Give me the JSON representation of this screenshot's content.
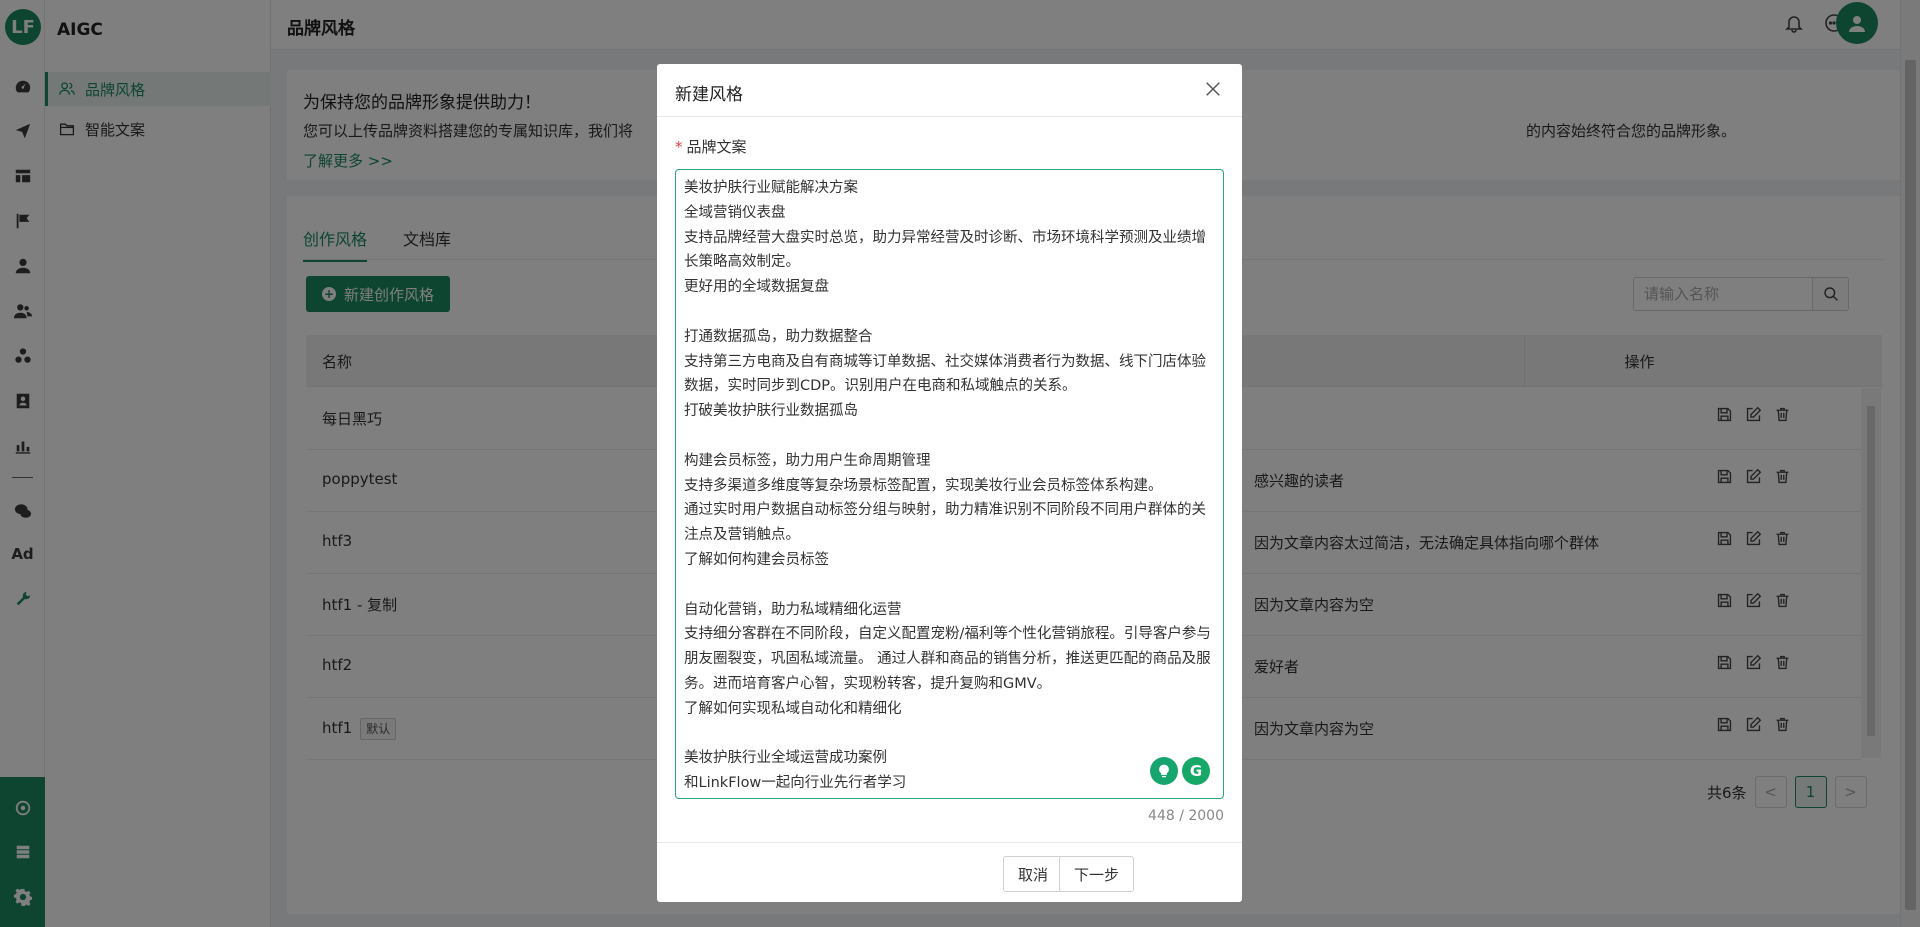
{
  "app": {
    "name": "AIGC",
    "logo_glyph": "LF"
  },
  "colors": {
    "brand": "#1a8a60",
    "grammarly_green": "#15a867",
    "idea_green": "#16a56e",
    "required": "#e04040"
  },
  "rail_icons": [
    "dashboard-icon",
    "send-icon",
    "layout-icon",
    "flag-icon",
    "user-icon",
    "users-icon",
    "group-icon",
    "id-card-icon",
    "bar-chart-icon",
    "wechat-icon",
    "ad-icon",
    "wrench-icon",
    "atom-icon",
    "server-icon",
    "gear-icon"
  ],
  "rail_ad_text": "Ad",
  "sidebar": {
    "items": [
      {
        "label": "品牌风格",
        "active": true
      },
      {
        "label": "智能文案",
        "active": false
      }
    ]
  },
  "header": {
    "title": "品牌风格"
  },
  "info": {
    "heading": "为保持您的品牌形象提供助力！",
    "text_left": "您可以上传品牌资料搭建您的专属知识库，我们将",
    "text_right": "的内容始终符合您的品牌形象。",
    "more": "了解更多 >>"
  },
  "tabs": [
    {
      "label": "创作风格",
      "active": true
    },
    {
      "label": "文档库",
      "active": false
    }
  ],
  "toolbar": {
    "new_label": "新建创作风格",
    "search_placeholder": "请输入名称"
  },
  "table": {
    "columns": [
      "名称",
      "",
      "操作"
    ],
    "rows": [
      {
        "name": "每日黑巧",
        "badge": "",
        "desc": ""
      },
      {
        "name": "poppytest",
        "badge": "",
        "desc": "感兴趣的读者"
      },
      {
        "name": "htf3",
        "badge": "",
        "desc": "因为文章内容太过简洁，无法确定具体指向哪个群体"
      },
      {
        "name": "htf1 - 复制",
        "badge": "",
        "desc": "因为文章内容为空"
      },
      {
        "name": "htf2",
        "badge": "",
        "desc": "爱好者"
      },
      {
        "name": "htf1",
        "badge": "默认",
        "desc": "因为文章内容为空"
      }
    ]
  },
  "pagination": {
    "total": "共6条",
    "current": "1",
    "prev": "<",
    "next": ">"
  },
  "modal": {
    "title": "新建风格",
    "field_label": "品牌文案",
    "required_mark": "*",
    "content": "美妆护肤行业赋能解决方案\n全域营销仪表盘\n支持品牌经营大盘实时总览，助力异常经营及时诊断、市场环境科学预测及业绩增长策略高效制定。\n更好用的全域数据复盘\n\n打通数据孤岛，助力数据整合\n支持第三方电商及自有商城等订单数据、社交媒体消费者行为数据、线下门店体验数据，实时同步到CDP。识别用户在电商和私域触点的关系。\n打破美妆护肤行业数据孤岛\n\n构建会员标签，助力用户生命周期管理\n支持多渠道多维度等复杂场景标签配置，实现美妆行业会员标签体系构建。\n通过实时用户数据自动标签分组与映射，助力精准识别不同阶段不同用户群体的关注点及营销触点。\n了解如何构建会员标签\n\n自动化营销，助力私域精细化运营\n支持细分客群在不同阶段，自定义配置宠粉/福利等个性化营销旅程。引导客户参与朋友圈裂变，巩固私域流量。 通过人群和商品的销售分析，推送更匹配的商品及服务。进而培育客户心智，实现粉转客，提升复购和GMV。\n了解如何实现私域自动化和精细化\n\n美妆护肤行业全域运营成功案例\n和LinkFlow一起向行业先行者学习",
    "char_count": "448 / 2000",
    "cancel_label": "取消",
    "next_label": "下一步",
    "grammarly_glyph": "G"
  }
}
